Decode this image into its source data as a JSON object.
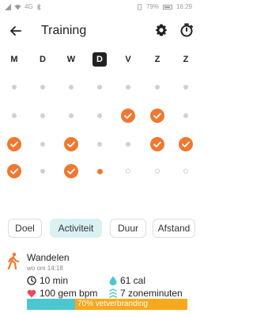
{
  "status_bar": {
    "network": "4G",
    "battery": "79%",
    "time": "16:29"
  },
  "header": {
    "title": "Training"
  },
  "week_days": [
    "M",
    "D",
    "W",
    "D",
    "V",
    "Z",
    "Z"
  ],
  "today_index": 3,
  "calendar_rows": [
    [
      "past",
      "past",
      "past",
      "past",
      "past",
      "past",
      "past"
    ],
    [
      "past",
      "past",
      "past",
      "past",
      "done",
      "done",
      "past"
    ],
    [
      "done",
      "past",
      "done",
      "past",
      "past",
      "done",
      "done"
    ],
    [
      "done",
      "past",
      "done",
      "active",
      "future",
      "future",
      "future"
    ]
  ],
  "filters": {
    "items": [
      "Doel",
      "Activiteit",
      "Duur",
      "Afstand"
    ],
    "selected": "Activiteit"
  },
  "activity": {
    "name": "Wandelen",
    "time": "wo om 14:18",
    "duration": "10 min",
    "calories": "61 cal",
    "heart_rate": "100 gem bpm",
    "zone_minutes": "7 zoneminuten",
    "bar_label": "70% vetverbranding",
    "fat_burn_fraction": 0.7
  },
  "colors": {
    "accent": "#f07830",
    "teal": "#4cc7cf",
    "orange_bar": "#f8a81c",
    "heart": "#e84a5f",
    "chip_selected_bg": "#d9f1f2"
  }
}
